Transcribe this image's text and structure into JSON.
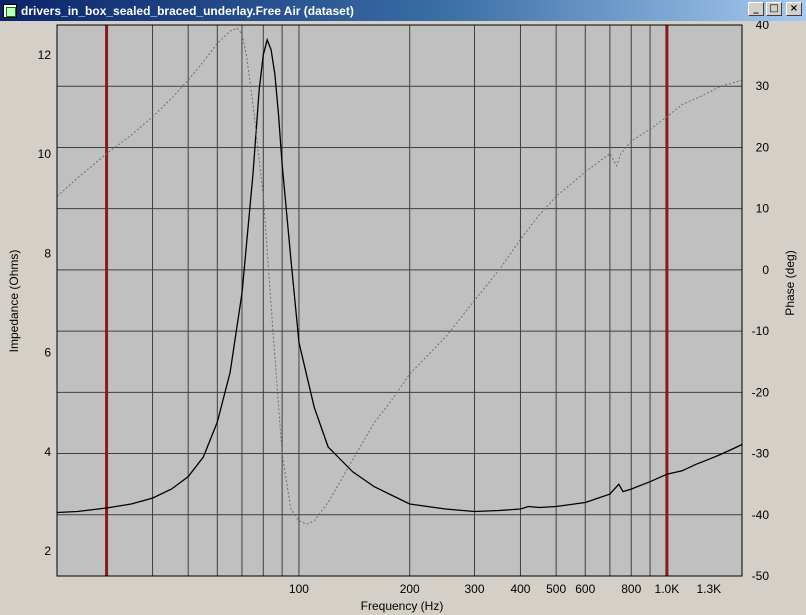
{
  "window": {
    "title": "drivers_in_box_sealed_braced_underlay.Free Air (dataset)",
    "buttons": {
      "minimize": "_",
      "maximize": "□",
      "close": "×"
    }
  },
  "chart_data": {
    "type": "line",
    "xscale": "log",
    "xlabel": "Frequency (Hz)",
    "ylabel": "Impedance (Ohms)",
    "y2label": "Phase (deg)",
    "xlim": [
      22,
      1600
    ],
    "ylim": [
      1.5,
      12.6
    ],
    "y2lim": [
      -50,
      40
    ],
    "x_tick_labels": [
      {
        "v": 100,
        "label": "100"
      },
      {
        "v": 200,
        "label": "200"
      },
      {
        "v": 300,
        "label": "300"
      },
      {
        "v": 400,
        "label": "400"
      },
      {
        "v": 500,
        "label": "500"
      },
      {
        "v": 600,
        "label": "600"
      },
      {
        "v": 800,
        "label": "800"
      },
      {
        "v": 1000,
        "label": "1.0K"
      },
      {
        "v": 1300,
        "label": "1.3K"
      }
    ],
    "y_ticks": [
      2,
      4,
      6,
      8,
      10,
      12
    ],
    "y2_ticks": [
      -50,
      -40,
      -30,
      -20,
      -10,
      0,
      10,
      20,
      30,
      40
    ],
    "markers": [
      30,
      1000
    ],
    "grid": true,
    "colors": {
      "plot_background": "#c0c0c0",
      "grid": "#404040",
      "impedance": "#000000",
      "phase": "#6e6e6e",
      "marker": "#8b1a1a"
    },
    "series": [
      {
        "axis": "left",
        "style": "solid",
        "x": [
          22,
          25,
          30,
          35,
          40,
          45,
          50,
          55,
          60,
          65,
          70,
          75,
          78,
          80,
          82,
          84,
          86,
          88,
          90,
          95,
          100,
          110,
          120,
          140,
          160,
          200,
          250,
          300,
          350,
          400,
          420,
          450,
          500,
          600,
          700,
          740,
          760,
          800,
          900,
          1000,
          1100,
          1200,
          1300,
          1400,
          1500,
          1600
        ],
        "values": [
          2.78,
          2.8,
          2.87,
          2.95,
          3.07,
          3.25,
          3.5,
          3.9,
          4.6,
          5.6,
          7.2,
          9.6,
          11.3,
          12.0,
          12.3,
          12.1,
          11.6,
          10.8,
          9.8,
          7.9,
          6.2,
          4.9,
          4.1,
          3.6,
          3.3,
          2.95,
          2.85,
          2.8,
          2.82,
          2.85,
          2.9,
          2.88,
          2.9,
          2.98,
          3.15,
          3.35,
          3.2,
          3.25,
          3.4,
          3.55,
          3.62,
          3.75,
          3.85,
          3.95,
          4.05,
          4.15
        ]
      },
      {
        "axis": "right",
        "style": "dotted",
        "x": [
          22,
          25,
          30,
          35,
          40,
          45,
          50,
          55,
          60,
          65,
          68,
          70,
          72,
          75,
          80,
          85,
          90,
          95,
          100,
          105,
          110,
          120,
          140,
          160,
          180,
          200,
          250,
          300,
          350,
          400,
          450,
          500,
          600,
          700,
          730,
          750,
          800,
          900,
          1000,
          1100,
          1200,
          1300,
          1400,
          1500,
          1600
        ],
        "values": [
          12,
          15,
          19,
          22,
          25,
          28,
          31,
          34,
          37,
          39,
          39.5,
          38.5,
          35,
          27,
          12,
          -10,
          -30,
          -39,
          -41,
          -41.5,
          -41,
          -38,
          -31,
          -25,
          -21,
          -17,
          -11,
          -5,
          0,
          5,
          9,
          12,
          16,
          19,
          17,
          19,
          21,
          23,
          25,
          27,
          28,
          29,
          30,
          30.5,
          31
        ]
      }
    ]
  }
}
